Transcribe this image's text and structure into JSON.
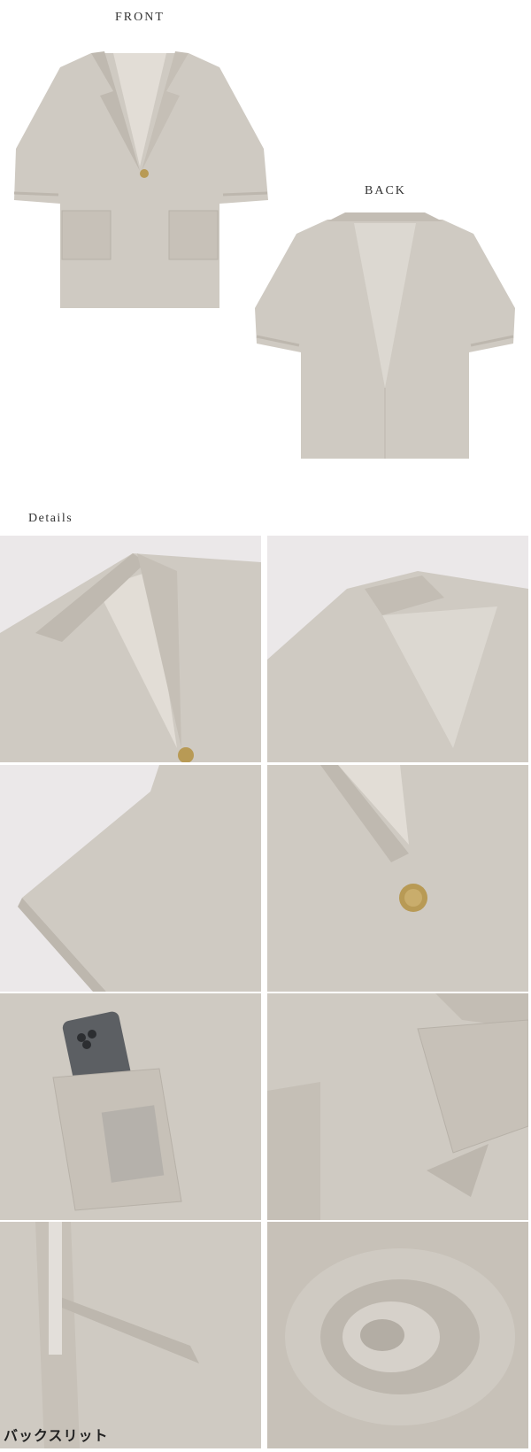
{
  "labels": {
    "front": "FRONT",
    "back": "BACK",
    "details": "Details"
  },
  "detail_caption": "バックスリット",
  "colors": {
    "fabric": "#cfcac2",
    "fabric_shadow": "#bdb7ae",
    "fabric_light": "#dbd7d0",
    "background": "#ebe8e9",
    "button_gold": "#b89a55",
    "phone": "#5c5f63"
  }
}
